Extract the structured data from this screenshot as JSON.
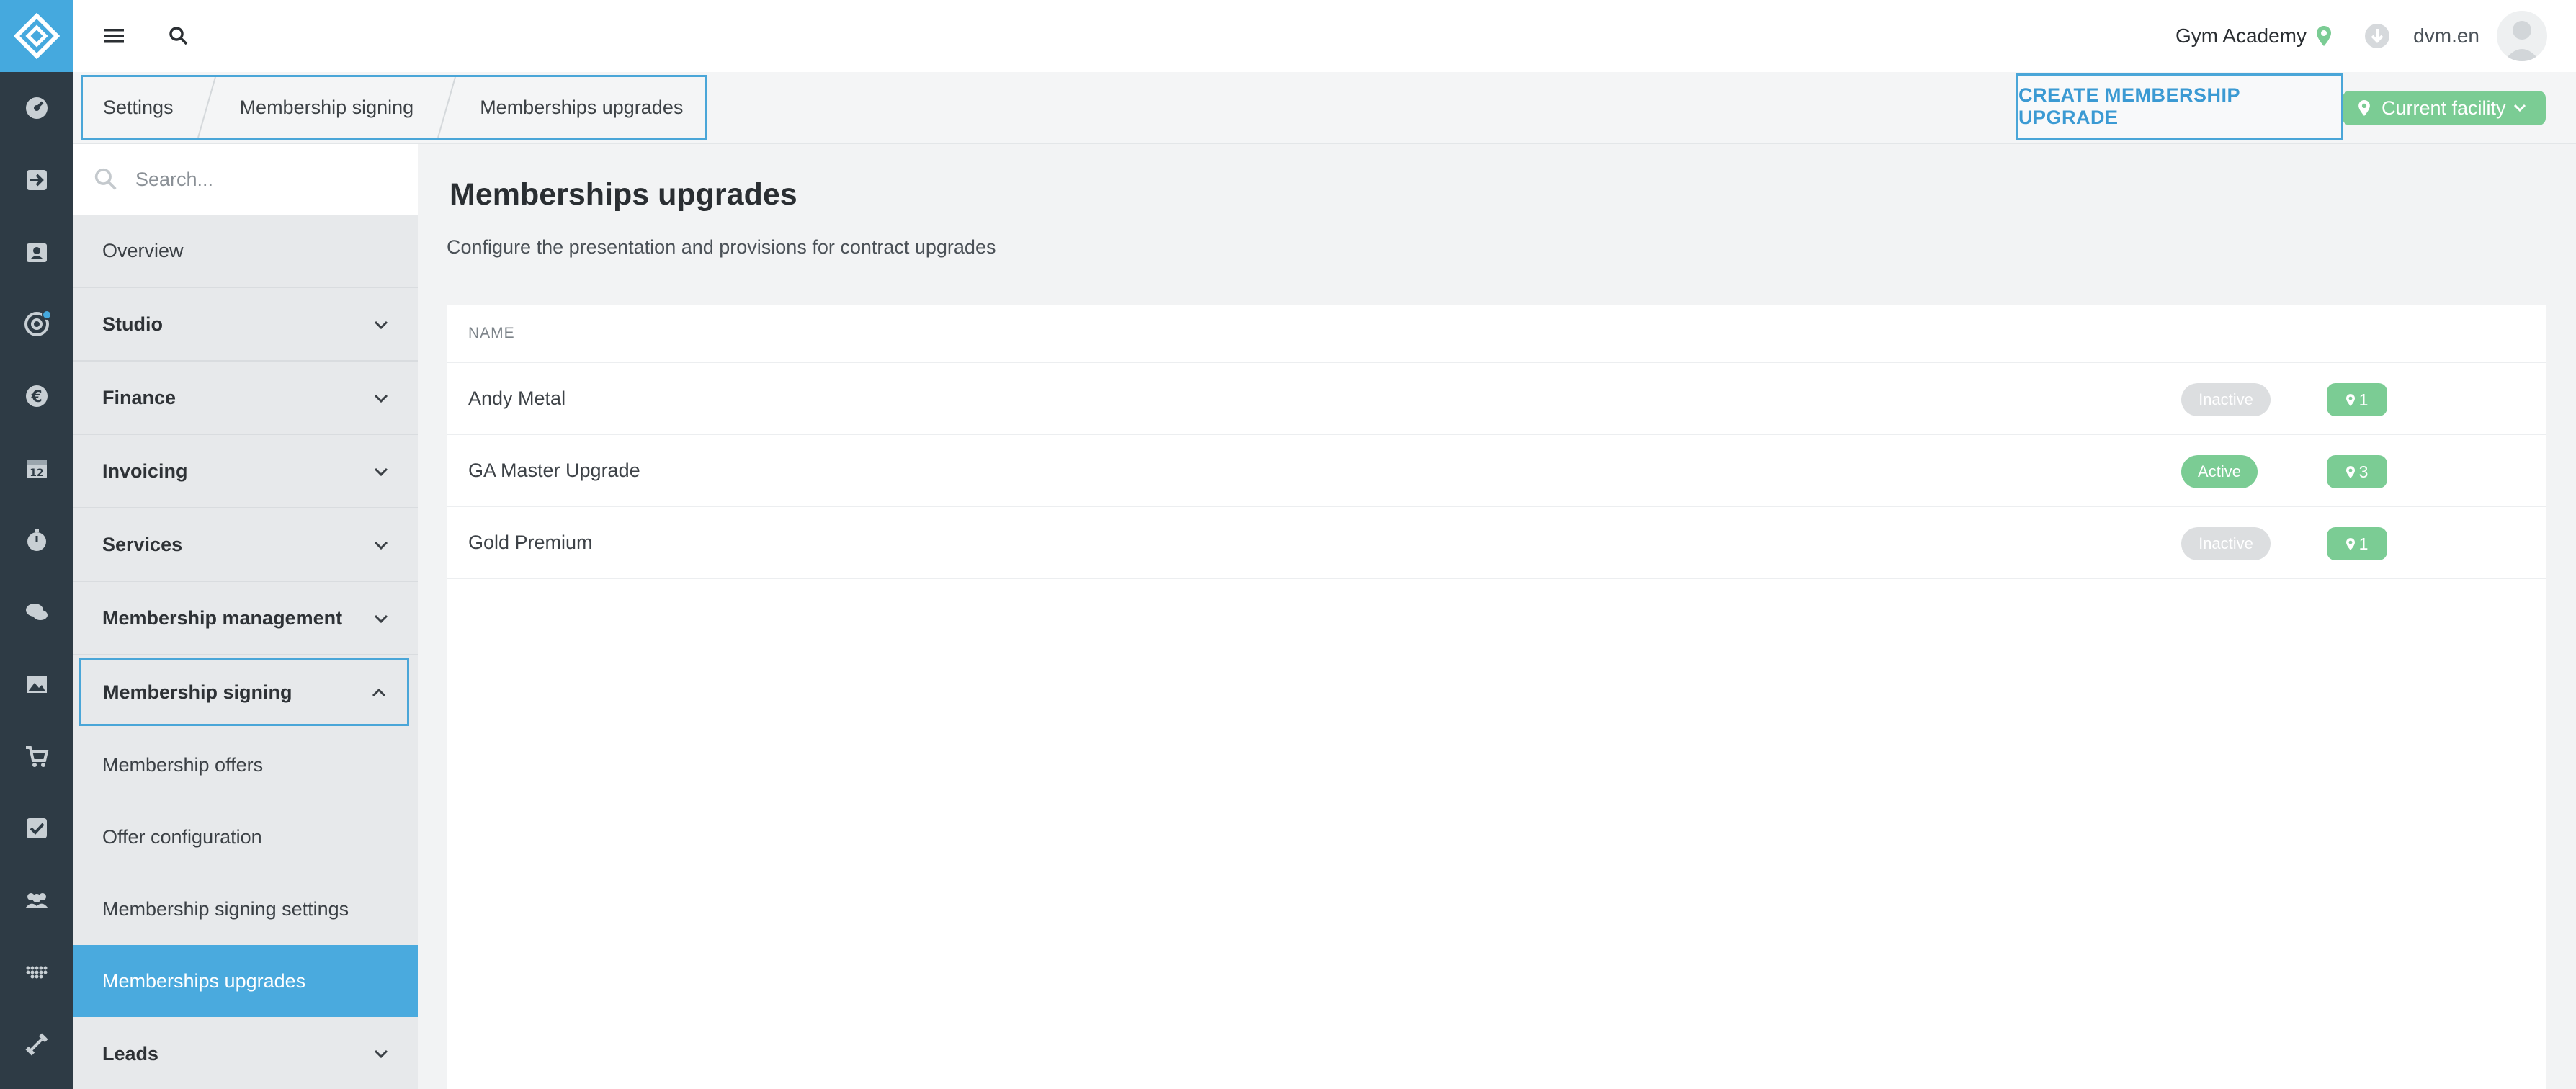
{
  "colors": {
    "rail_bg": "#2e3b45",
    "accent": "#45a9de",
    "active_green": "#7bcc94",
    "inactive_gray": "#dcdee0"
  },
  "topbar": {
    "menu_icon": "hamburger-icon",
    "search_icon": "search-icon",
    "gym_name": "Gym Academy",
    "gym_icon": "map-pin-icon",
    "download_icon": "download-icon",
    "username": "dvm.en"
  },
  "rail": {
    "items": [
      {
        "icon": "dashboard-icon"
      },
      {
        "icon": "check-in-icon"
      },
      {
        "icon": "contacts-icon"
      },
      {
        "icon": "target-icon",
        "badge": true
      },
      {
        "icon": "euro-icon"
      },
      {
        "icon": "calendar-icon"
      },
      {
        "icon": "stopwatch-icon"
      },
      {
        "icon": "chat-icon"
      },
      {
        "icon": "image-icon"
      },
      {
        "icon": "cart-icon"
      },
      {
        "icon": "checkbox-icon"
      },
      {
        "icon": "group-icon"
      },
      {
        "icon": "dots-grid-icon"
      },
      {
        "icon": "dumbbell-icon"
      }
    ]
  },
  "breadcrumb": [
    "Settings",
    "Membership signing",
    "Memberships upgrades"
  ],
  "actions": {
    "create_label": "CREATE MEMBERSHIP UPGRADE",
    "facility_label": "Current facility"
  },
  "sidebar": {
    "search_placeholder": "Search...",
    "overview": "Overview",
    "groups": [
      {
        "label": "Studio"
      },
      {
        "label": "Finance"
      },
      {
        "label": "Invoicing"
      },
      {
        "label": "Services"
      },
      {
        "label": "Membership management"
      }
    ],
    "expanded_group": "Membership signing",
    "sub_items": [
      "Membership offers",
      "Offer configuration",
      "Membership signing settings",
      "Memberships upgrades"
    ],
    "selected_index": 3,
    "last_group": "Leads"
  },
  "main": {
    "title": "Memberships upgrades",
    "description": "Configure the presentation and provisions for contract upgrades",
    "column_header": "NAME",
    "rows": [
      {
        "name": "Andy Metal",
        "status": "Inactive",
        "facilities": "1"
      },
      {
        "name": "GA Master Upgrade",
        "status": "Active",
        "facilities": "3"
      },
      {
        "name": "Gold Premium",
        "status": "Inactive",
        "facilities": "1"
      }
    ]
  }
}
